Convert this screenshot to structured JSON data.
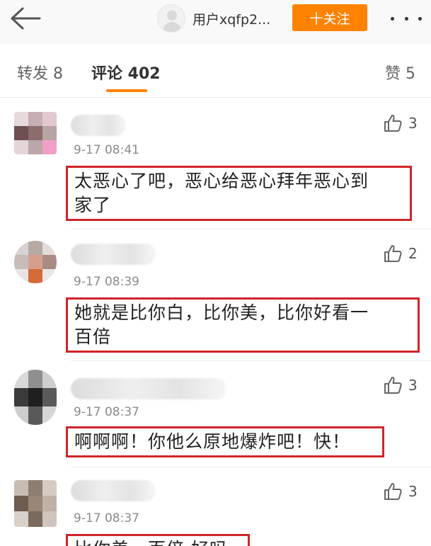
{
  "header": {
    "user_name": "用户xqfp2...",
    "follow_label": "十关注"
  },
  "tabs": {
    "forward": "转发 8",
    "comments": "评论 402",
    "likes": "赞 5"
  },
  "colors": {
    "accent": "#ff8200",
    "highlight_box": "#d0242b"
  },
  "comments": [
    {
      "time": "9-17 08:41",
      "likes": "3",
      "text_line1": "太恶心了吧，恶心给恶心拜年恶心到",
      "text_line2": "家了"
    },
    {
      "time": "9-17 08:39",
      "likes": "2",
      "text_line1": "她就是比你白，比你美，比你好看一",
      "text_line2": "百倍"
    },
    {
      "time": "9-17 08:37",
      "likes": "3",
      "text_line1": "啊啊啊！你他么原地爆炸吧！快！"
    },
    {
      "time": "9-17 08:37",
      "likes": "3",
      "text_line1": "比你美一百倍 好吗"
    }
  ]
}
